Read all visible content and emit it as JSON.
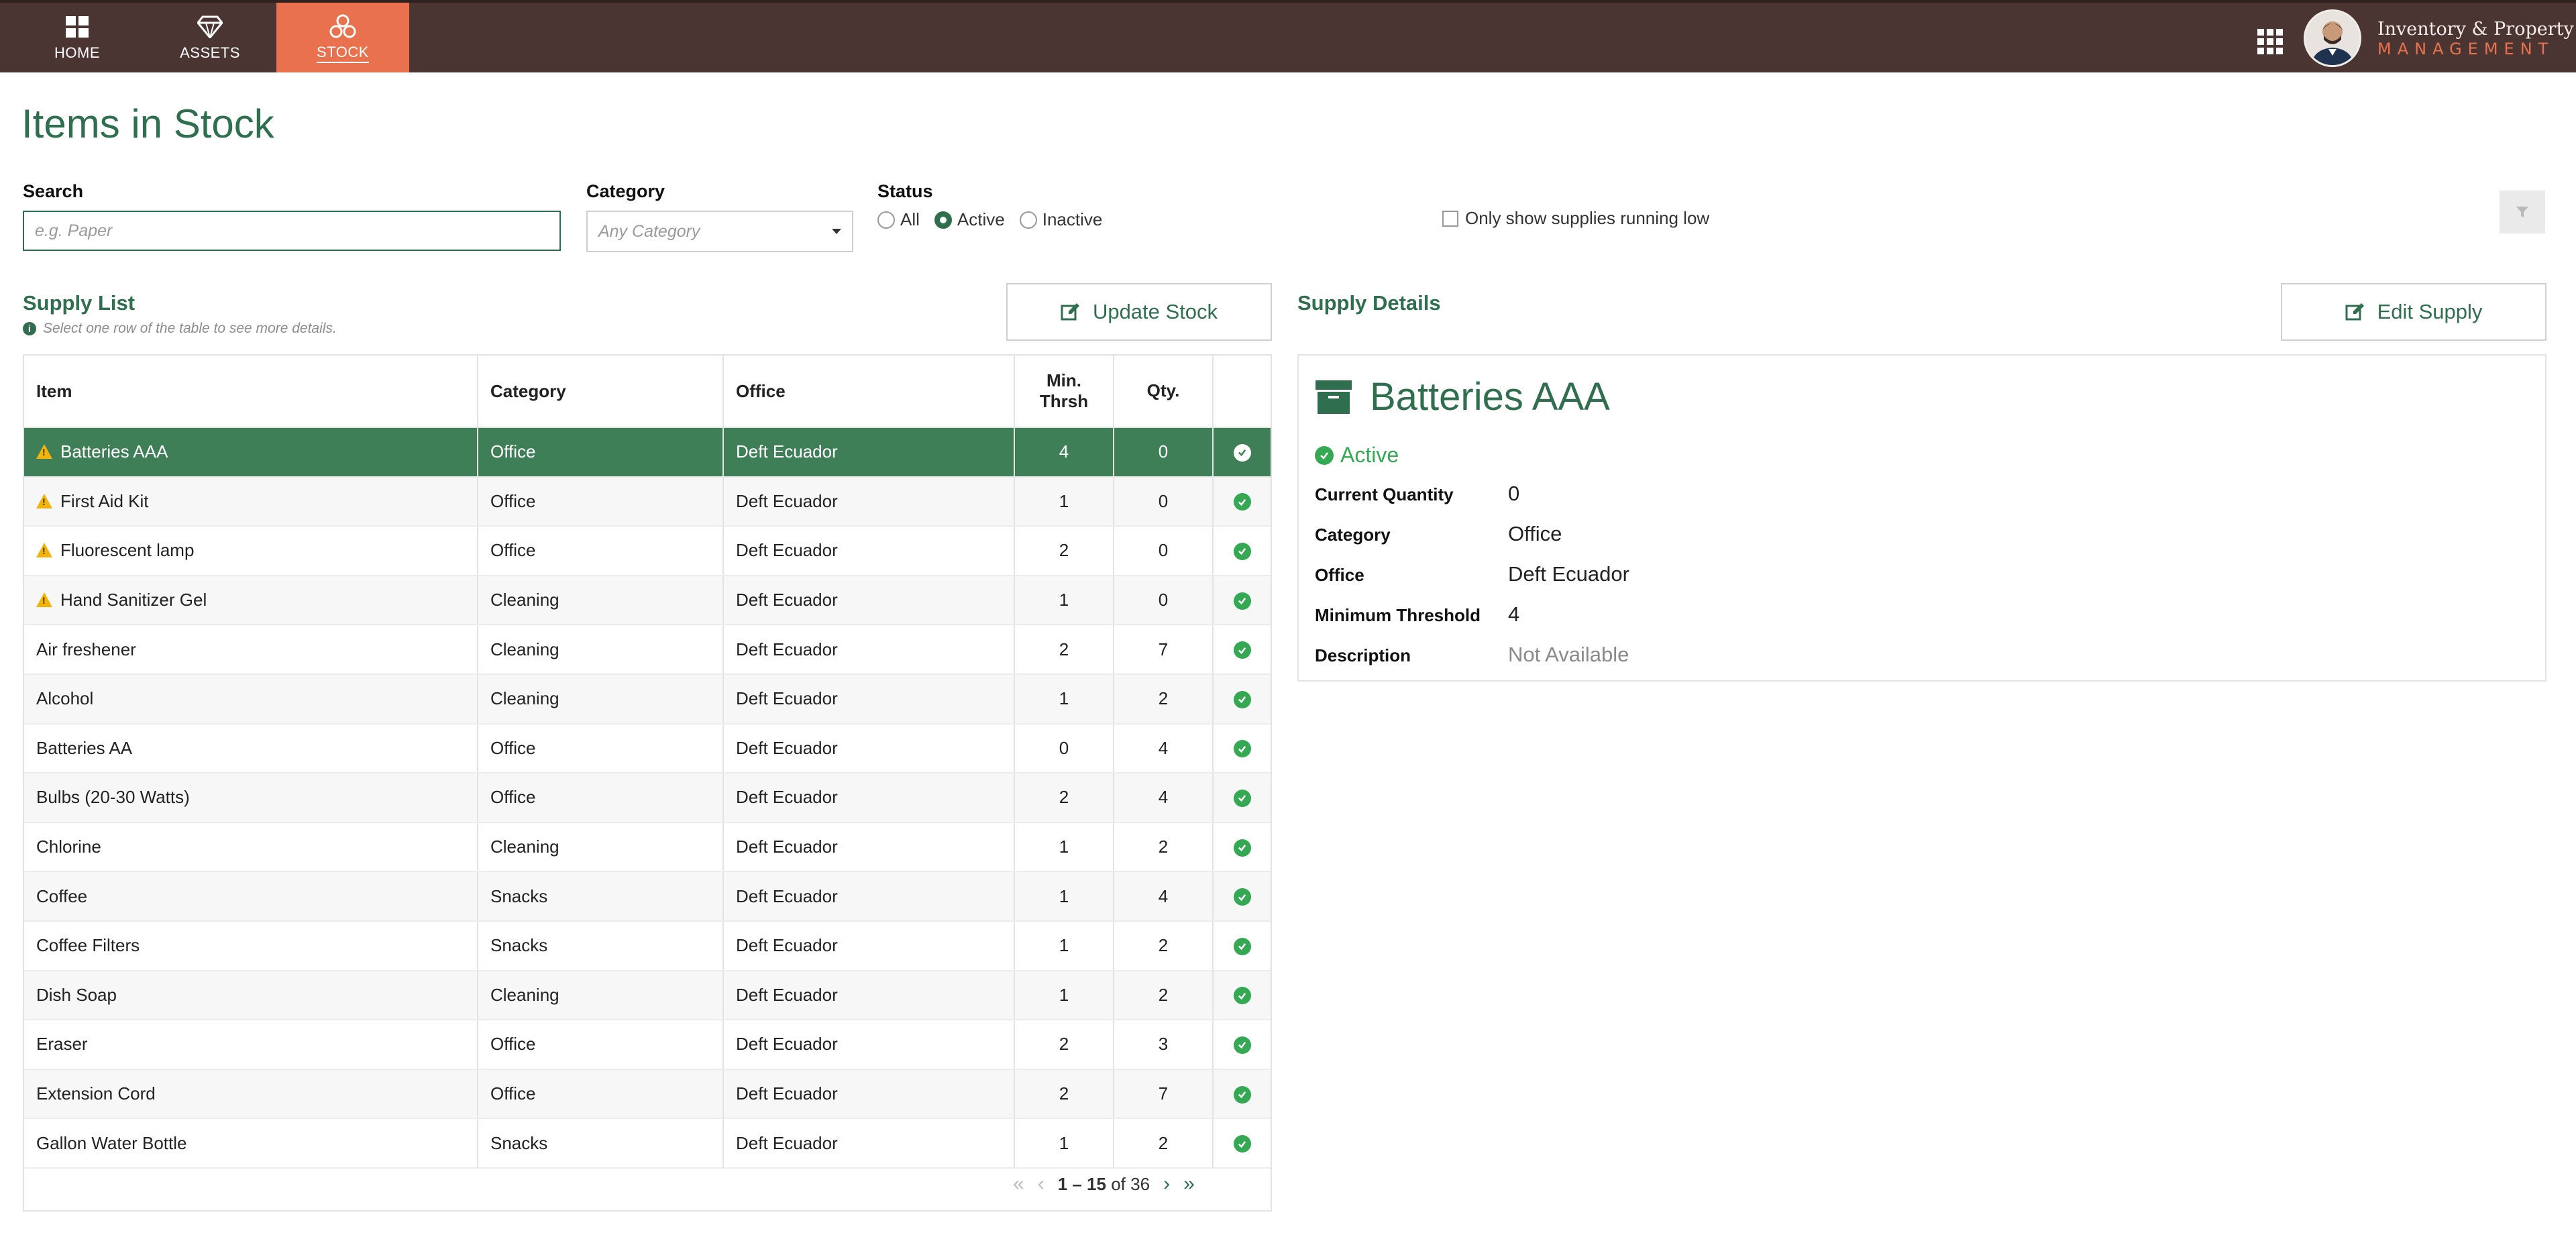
{
  "nav": {
    "tabs": [
      {
        "label": "HOME",
        "icon": "home-grid-icon"
      },
      {
        "label": "ASSETS",
        "icon": "diamond-icon"
      },
      {
        "label": "STOCK",
        "icon": "boxes-icon",
        "active": true
      }
    ],
    "brand_line1": "Inventory & Property",
    "brand_line2": "MANAGEMENT"
  },
  "page": {
    "title": "Items in Stock"
  },
  "filters": {
    "search_label": "Search",
    "search_placeholder": "e.g. Paper",
    "category_label": "Category",
    "category_value": "Any Category",
    "status_label": "Status",
    "status_options": [
      "All",
      "Active",
      "Inactive"
    ],
    "status_selected": "Active",
    "low_supply_label": "Only show supplies running low"
  },
  "supply_list": {
    "title": "Supply List",
    "hint": "Select one row of the table to see more details.",
    "update_button": "Update Stock",
    "columns": [
      "Item",
      "Category",
      "Office",
      "Min.\nThrsh",
      "Qty."
    ],
    "rows": [
      {
        "item": "Batteries AAA",
        "category": "Office",
        "office": "Deft Ecuador",
        "min": "4",
        "qty": "0",
        "warn": true,
        "selected": true
      },
      {
        "item": "First Aid Kit",
        "category": "Office",
        "office": "Deft Ecuador",
        "min": "1",
        "qty": "0",
        "warn": true
      },
      {
        "item": "Fluorescent lamp",
        "category": "Office",
        "office": "Deft Ecuador",
        "min": "2",
        "qty": "0",
        "warn": true
      },
      {
        "item": "Hand Sanitizer Gel",
        "category": "Cleaning",
        "office": "Deft Ecuador",
        "min": "1",
        "qty": "0",
        "warn": true
      },
      {
        "item": "Air freshener",
        "category": "Cleaning",
        "office": "Deft Ecuador",
        "min": "2",
        "qty": "7"
      },
      {
        "item": "Alcohol",
        "category": "Cleaning",
        "office": "Deft Ecuador",
        "min": "1",
        "qty": "2"
      },
      {
        "item": "Batteries AA",
        "category": "Office",
        "office": "Deft Ecuador",
        "min": "0",
        "qty": "4"
      },
      {
        "item": "Bulbs (20-30 Watts)",
        "category": "Office",
        "office": "Deft Ecuador",
        "min": "2",
        "qty": "4"
      },
      {
        "item": "Chlorine",
        "category": "Cleaning",
        "office": "Deft Ecuador",
        "min": "1",
        "qty": "2"
      },
      {
        "item": "Coffee",
        "category": "Snacks",
        "office": "Deft Ecuador",
        "min": "1",
        "qty": "4"
      },
      {
        "item": "Coffee Filters",
        "category": "Snacks",
        "office": "Deft Ecuador",
        "min": "1",
        "qty": "2"
      },
      {
        "item": "Dish Soap",
        "category": "Cleaning",
        "office": "Deft Ecuador",
        "min": "1",
        "qty": "2"
      },
      {
        "item": "Eraser",
        "category": "Office",
        "office": "Deft Ecuador",
        "min": "2",
        "qty": "3"
      },
      {
        "item": "Extension Cord",
        "category": "Office",
        "office": "Deft Ecuador",
        "min": "2",
        "qty": "7"
      },
      {
        "item": "Gallon Water Bottle",
        "category": "Snacks",
        "office": "Deft Ecuador",
        "min": "1",
        "qty": "2"
      }
    ],
    "pager": {
      "range": "1 – 15",
      "of_word": "of",
      "total": "36"
    }
  },
  "details": {
    "title": "Supply Details",
    "edit_button": "Edit Supply",
    "name": "Batteries AAA",
    "status": "Active",
    "fields": [
      {
        "key": "Current Quantity",
        "value": "0"
      },
      {
        "key": "Category",
        "value": "Office"
      },
      {
        "key": "Office",
        "value": "Deft Ecuador"
      },
      {
        "key": "Minimum Threshold",
        "value": "4"
      },
      {
        "key": "Description",
        "value": "Not Available",
        "muted": true
      }
    ]
  },
  "colors": {
    "brand_green": "#2f6e4f",
    "topbar": "#4a3532",
    "accent": "#e9714d",
    "ok": "#35a853",
    "warn": "#f1b40f"
  }
}
